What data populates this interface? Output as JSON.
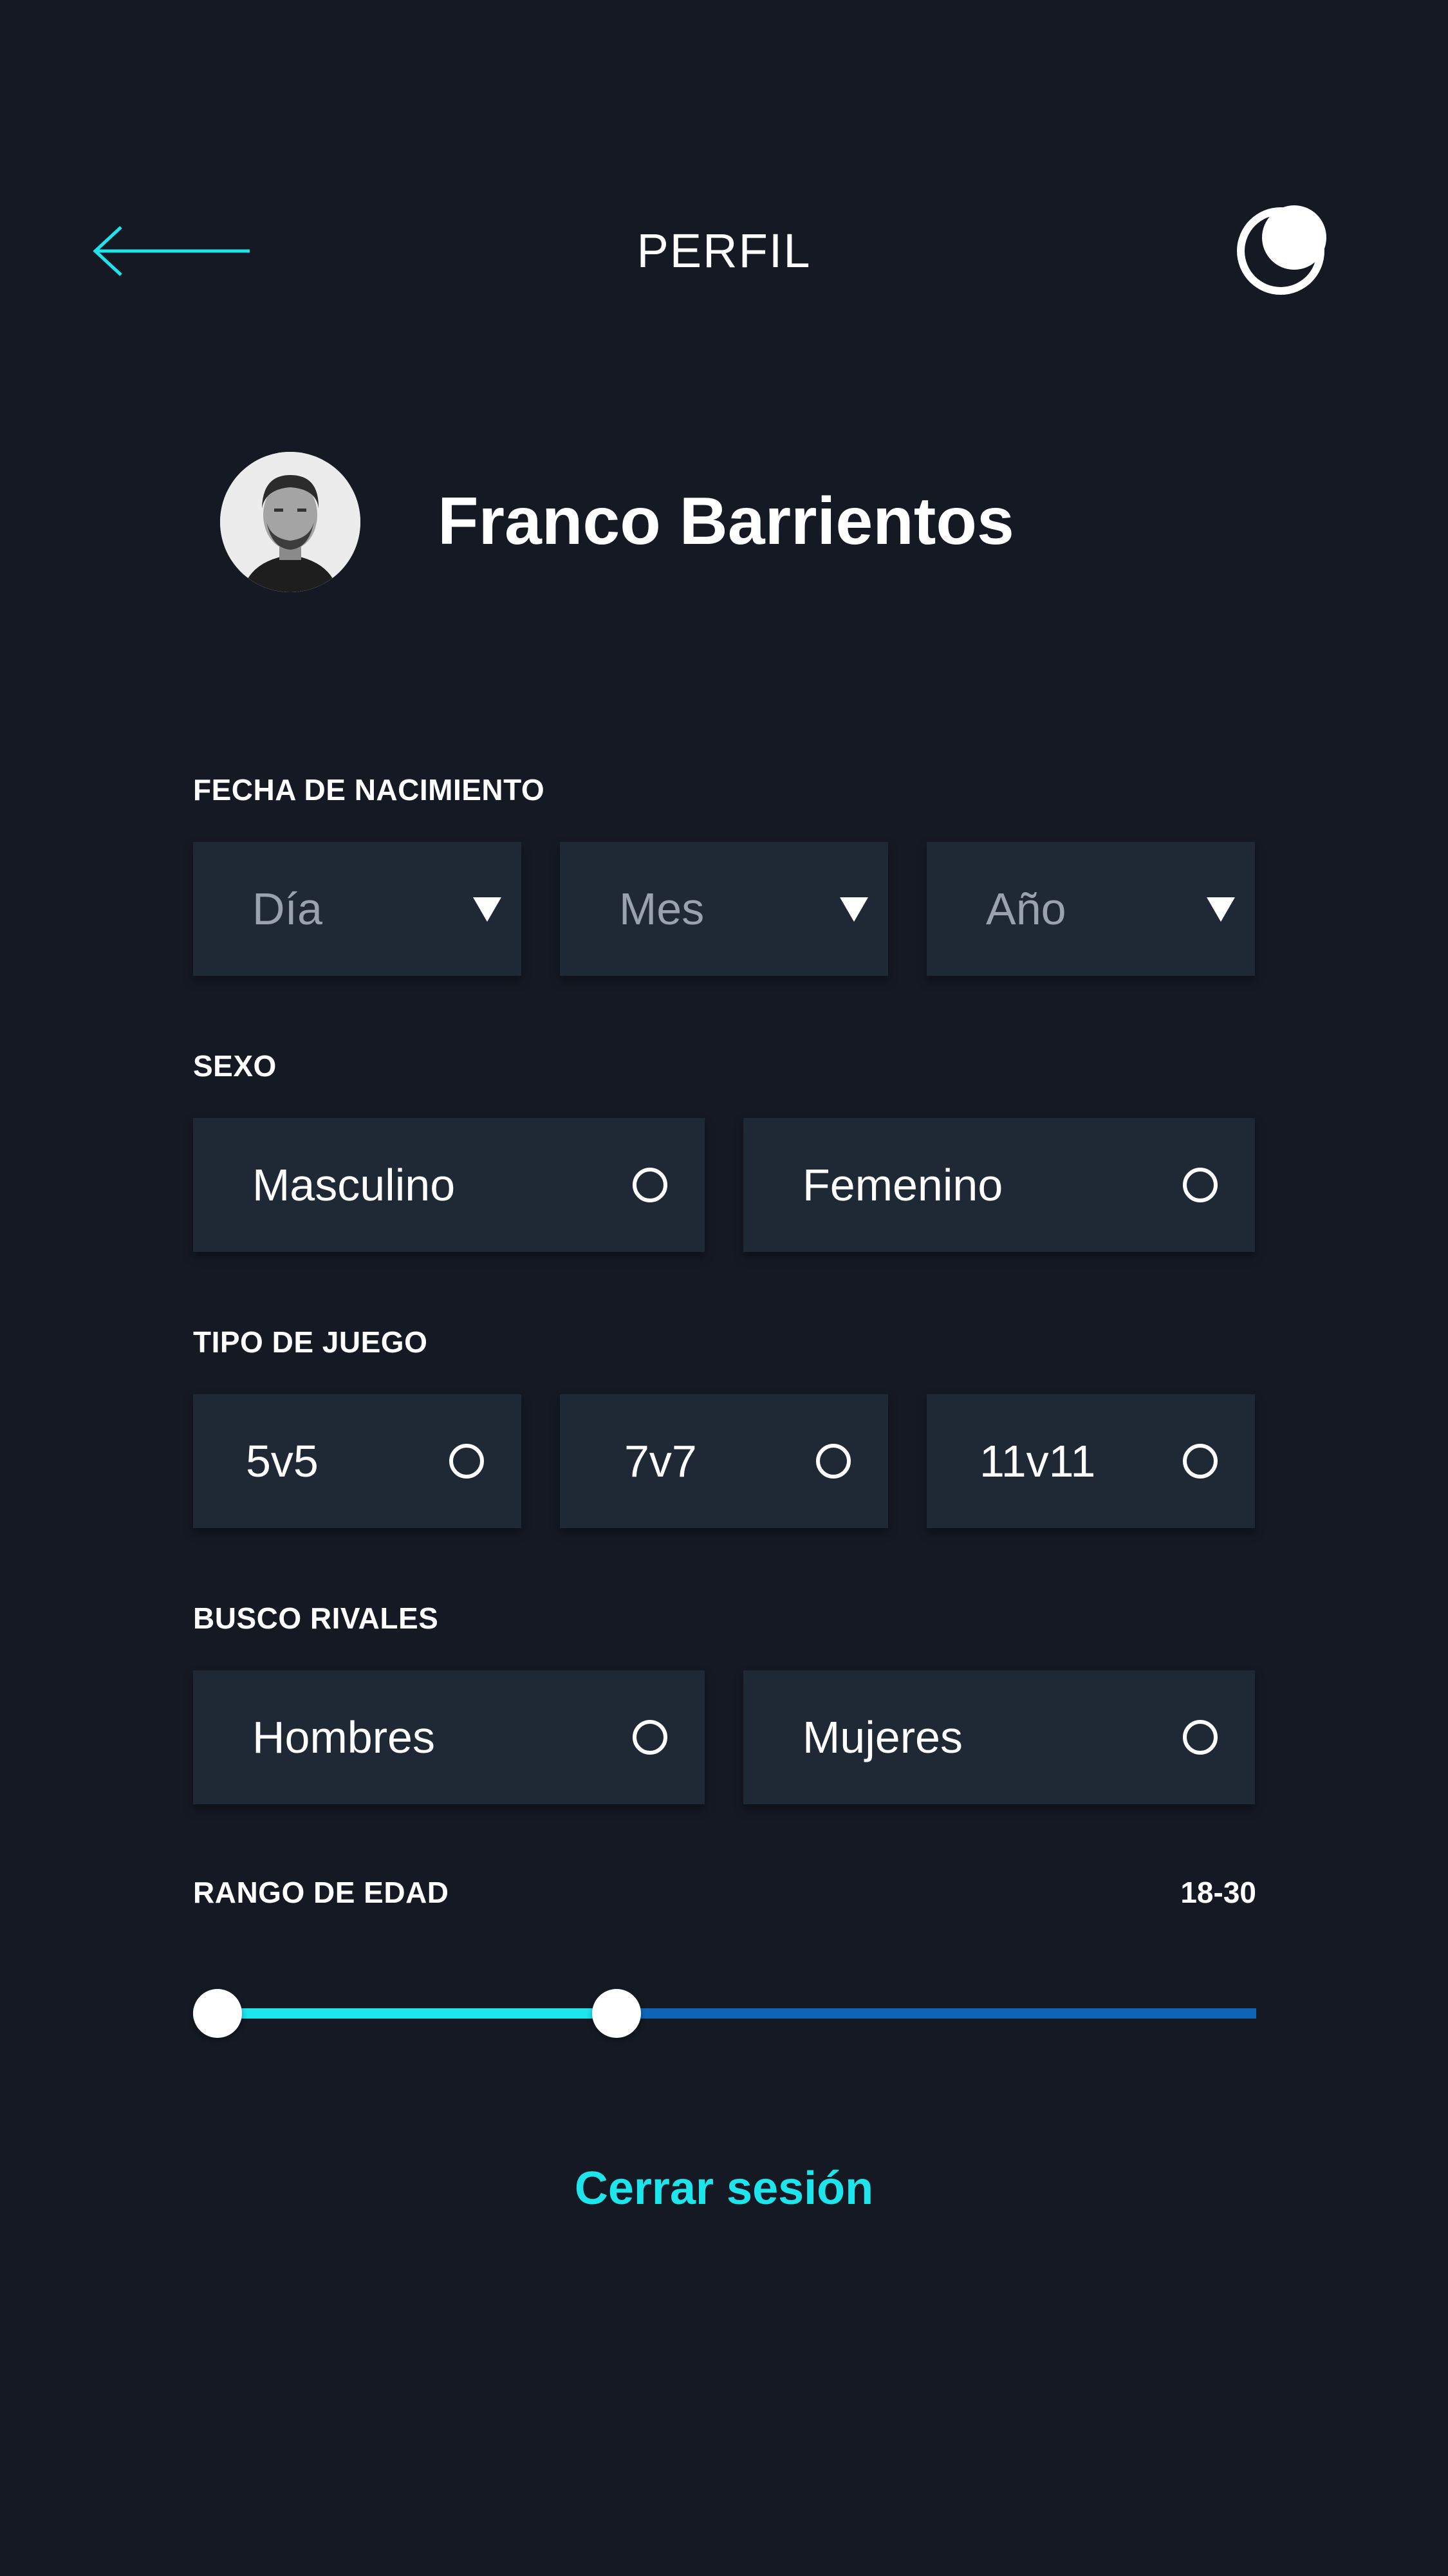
{
  "header": {
    "title": "PERFIL",
    "back_icon": "arrow-left-icon",
    "theme_icon": "moon-icon"
  },
  "profile": {
    "name": "Franco Barrientos",
    "avatar_icon": "avatar-photo"
  },
  "birth_date": {
    "label": "FECHA DE NACIMIENTO",
    "day_placeholder": "Día",
    "month_placeholder": "Mes",
    "year_placeholder": "Año"
  },
  "sex": {
    "label": "SEXO",
    "options": [
      "Masculino",
      "Femenino"
    ]
  },
  "game_type": {
    "label": "TIPO DE JUEGO",
    "options": [
      "5v5",
      "7v7",
      "11v11"
    ]
  },
  "rivals": {
    "label": "BUSCO RIVALES",
    "options": [
      "Hombres",
      "Mujeres"
    ]
  },
  "age_range": {
    "label": "RANGO DE EDAD",
    "value": "18-30",
    "min": 18,
    "max": 30
  },
  "logout_label": "Cerrar sesión",
  "colors": {
    "background": "#141924",
    "field": "#1f2935",
    "accent": "#1ee4ec",
    "track": "#0f64b8"
  }
}
